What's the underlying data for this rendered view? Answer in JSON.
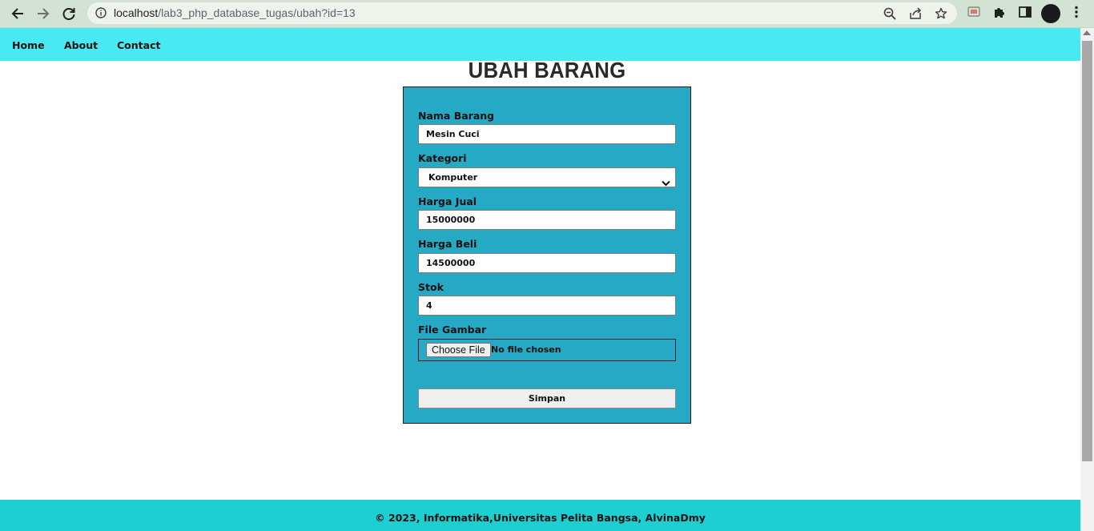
{
  "browser": {
    "url_host": "localhost",
    "url_path": "/lab3_php_database_tugas/ubah?id=13"
  },
  "nav": {
    "items": [
      "Home",
      "About",
      "Contact"
    ]
  },
  "page": {
    "title": "UBAH BARANG"
  },
  "form": {
    "nama_label": "Nama Barang",
    "nama_value": "Mesin Cuci",
    "kategori_label": "Kategori",
    "kategori_selected": "Komputer",
    "harga_jual_label": "Harga Jual",
    "harga_jual_value": "15000000",
    "harga_beli_label": "Harga Beli",
    "harga_beli_value": "14500000",
    "stok_label": "Stok",
    "stok_value": "4",
    "file_label": "File Gambar",
    "file_button": "Choose File",
    "file_status": "No file chosen",
    "submit_label": "Simpan"
  },
  "footer": {
    "text": "© 2023, Informatika,Universitas Pelita Bangsa, AlvinaDmy"
  },
  "colors": {
    "nav_bg": "#48e9f2",
    "card_bg": "#26a9c4",
    "footer_bg": "#1ecfd2"
  }
}
